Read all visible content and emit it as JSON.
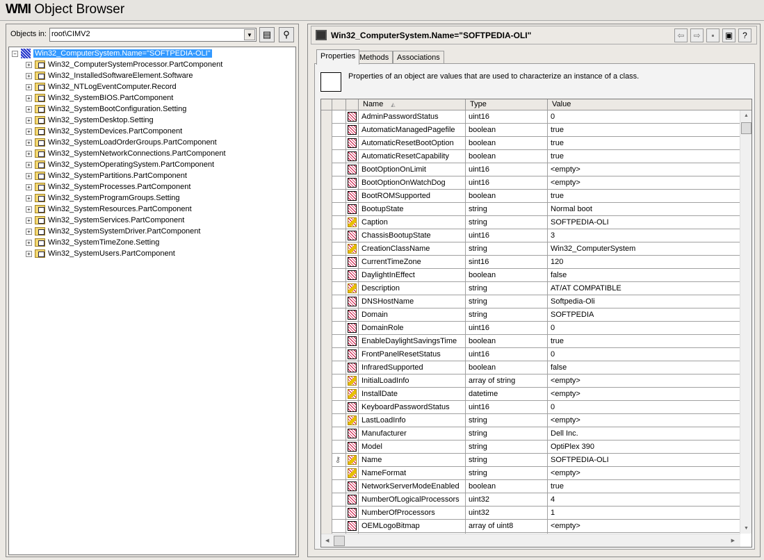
{
  "window": {
    "title_bold": "WMI",
    "title_rest": " Object Browser"
  },
  "left": {
    "objects_in_label": "Objects in:",
    "namespace": "root\\CIMV2",
    "toolbar": [
      {
        "icon": "browse-namespace-icon"
      },
      {
        "icon": "binoculars-find-icon"
      }
    ],
    "tree_root": "Win32_ComputerSystem.Name=\"SOFTPEDIA-OLI\"",
    "tree_items": [
      "Win32_ComputerSystemProcessor.PartComponent",
      "Win32_InstalledSoftwareElement.Software",
      "Win32_NTLogEventComputer.Record",
      "Win32_SystemBIOS.PartComponent",
      "Win32_SystemBootConfiguration.Setting",
      "Win32_SystemDesktop.Setting",
      "Win32_SystemDevices.PartComponent",
      "Win32_SystemLoadOrderGroups.PartComponent",
      "Win32_SystemNetworkConnections.PartComponent",
      "Win32_SystemOperatingSystem.PartComponent",
      "Win32_SystemPartitions.PartComponent",
      "Win32_SystemProcesses.PartComponent",
      "Win32_SystemProgramGroups.Setting",
      "Win32_SystemResources.PartComponent",
      "Win32_SystemServices.PartComponent",
      "Win32_SystemSystemDriver.PartComponent",
      "Win32_SystemTimeZone.Setting",
      "Win32_SystemUsers.PartComponent"
    ]
  },
  "right": {
    "header": "Win32_ComputerSystem.Name=\"SOFTPEDIA-OLI\"",
    "header_buttons": [
      {
        "icon": "back-arrow-icon",
        "glyph": "⇦"
      },
      {
        "icon": "forward-arrow-icon",
        "glyph": "⇨"
      },
      {
        "icon": "save-icon",
        "glyph": "▪"
      },
      {
        "icon": "view-instances-icon",
        "glyph": "▣"
      },
      {
        "icon": "help-icon",
        "glyph": "?"
      }
    ],
    "tabs": [
      "Properties",
      "Methods",
      "Associations"
    ],
    "active_tab": "Properties",
    "description": "Properties of an object are values that are used to characterize an instance of a class.",
    "columns": [
      "Name",
      "Type",
      "Value"
    ],
    "rows": [
      {
        "name": "AdminPasswordStatus",
        "type": "uint16",
        "value": "0",
        "icon": "property-icon"
      },
      {
        "name": "AutomaticManagedPagefile",
        "type": "boolean",
        "value": "true",
        "icon": "property-icon"
      },
      {
        "name": "AutomaticResetBootOption",
        "type": "boolean",
        "value": "true",
        "icon": "property-icon"
      },
      {
        "name": "AutomaticResetCapability",
        "type": "boolean",
        "value": "true",
        "icon": "property-icon"
      },
      {
        "name": "BootOptionOnLimit",
        "type": "uint16",
        "value": "<empty>",
        "icon": "property-icon"
      },
      {
        "name": "BootOptionOnWatchDog",
        "type": "uint16",
        "value": "<empty>",
        "icon": "property-icon"
      },
      {
        "name": "BootROMSupported",
        "type": "boolean",
        "value": "true",
        "icon": "property-icon"
      },
      {
        "name": "BootupState",
        "type": "string",
        "value": "Normal boot",
        "icon": "property-icon"
      },
      {
        "name": "Caption",
        "type": "string",
        "value": "SOFTPEDIA-OLI",
        "icon": "inherited-property-icon"
      },
      {
        "name": "ChassisBootupState",
        "type": "uint16",
        "value": "3",
        "icon": "property-icon"
      },
      {
        "name": "CreationClassName",
        "type": "string",
        "value": "Win32_ComputerSystem",
        "icon": "inherited-property-icon"
      },
      {
        "name": "CurrentTimeZone",
        "type": "sint16",
        "value": "120",
        "icon": "property-icon"
      },
      {
        "name": "DaylightInEffect",
        "type": "boolean",
        "value": "false",
        "icon": "property-icon"
      },
      {
        "name": "Description",
        "type": "string",
        "value": "AT/AT COMPATIBLE",
        "icon": "inherited-property-icon"
      },
      {
        "name": "DNSHostName",
        "type": "string",
        "value": "Softpedia-Oli",
        "icon": "property-icon"
      },
      {
        "name": "Domain",
        "type": "string",
        "value": "SOFTPEDIA",
        "icon": "property-icon"
      },
      {
        "name": "DomainRole",
        "type": "uint16",
        "value": "0",
        "icon": "property-icon"
      },
      {
        "name": "EnableDaylightSavingsTime",
        "type": "boolean",
        "value": "true",
        "icon": "property-icon"
      },
      {
        "name": "FrontPanelResetStatus",
        "type": "uint16",
        "value": "0",
        "icon": "property-icon"
      },
      {
        "name": "InfraredSupported",
        "type": "boolean",
        "value": "false",
        "icon": "property-icon"
      },
      {
        "name": "InitialLoadInfo",
        "type": "array of string",
        "value": "<empty>",
        "icon": "inherited-property-icon"
      },
      {
        "name": "InstallDate",
        "type": "datetime",
        "value": "<empty>",
        "icon": "inherited-property-icon"
      },
      {
        "name": "KeyboardPasswordStatus",
        "type": "uint16",
        "value": "0",
        "icon": "property-icon"
      },
      {
        "name": "LastLoadInfo",
        "type": "string",
        "value": "<empty>",
        "icon": "inherited-property-icon"
      },
      {
        "name": "Manufacturer",
        "type": "string",
        "value": "Dell Inc.",
        "icon": "property-icon"
      },
      {
        "name": "Model",
        "type": "string",
        "value": "OptiPlex 390",
        "icon": "property-icon"
      },
      {
        "name": "Name",
        "type": "string",
        "value": "SOFTPEDIA-OLI",
        "icon": "inherited-property-icon",
        "key": true
      },
      {
        "name": "NameFormat",
        "type": "string",
        "value": "<empty>",
        "icon": "inherited-property-icon"
      },
      {
        "name": "NetworkServerModeEnabled",
        "type": "boolean",
        "value": "true",
        "icon": "property-icon"
      },
      {
        "name": "NumberOfLogicalProcessors",
        "type": "uint32",
        "value": "4",
        "icon": "property-icon"
      },
      {
        "name": "NumberOfProcessors",
        "type": "uint32",
        "value": "1",
        "icon": "property-icon"
      },
      {
        "name": "OEMLogoBitmap",
        "type": "array of uint8",
        "value": "<empty>",
        "icon": "property-icon"
      }
    ]
  }
}
